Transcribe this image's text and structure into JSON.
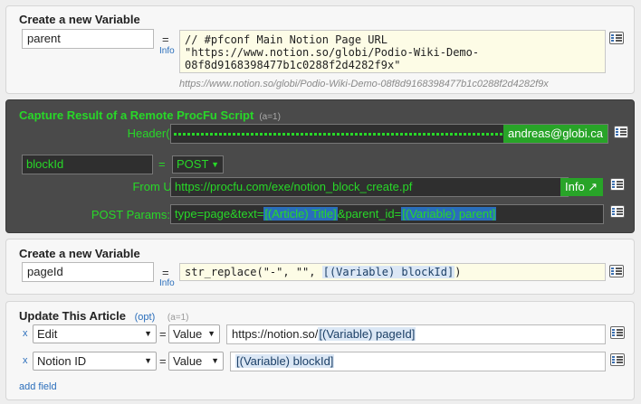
{
  "var1": {
    "title": "Create a new Variable",
    "name": "parent",
    "eq": "=",
    "info": "Info",
    "code_line1": "// #pfconf Main Notion Page URL",
    "code_line2": "\"https://www.notion.so/globi/Podio-Wiki-Demo-",
    "code_line3": "08f8d9168398477b1c0288f2d4282f9x\"",
    "result": "https://www.notion.so/globi/Podio-Wiki-Demo-08f8d9168398477b1c0288f2d4282f9x"
  },
  "procfu": {
    "title": "Capture Result of a Remote ProcFu Script",
    "subtitle": "(a=1)",
    "headers_label": "Header(s):",
    "headers_button": "andreas@globi.ca",
    "var_name": "blockId",
    "eq": "=",
    "method": "POST",
    "from_url_label": "From URL:",
    "from_url": "https://procfu.com/exe/notion_block_create.pf",
    "info_button": "Info ↗",
    "post_params_label": "POST Params:",
    "params_text1": "type=page&text=",
    "params_token1": "[(Article) Title]",
    "params_text2": "&parent_id=",
    "params_token2": "[(Variable) parent]"
  },
  "var2": {
    "title": "Create a new Variable",
    "name": "pageId",
    "eq": "=",
    "info": "Info",
    "code_text": "str_replace(\"-\", \"\", ",
    "code_token": "[(Variable) blockId]",
    "code_end": ")"
  },
  "update": {
    "title": "Update This Article",
    "opt": "(opt)",
    "subtitle": "(a=1)",
    "rows": [
      {
        "x": "x",
        "field": "Edit",
        "eq": "=",
        "mode": "Value",
        "text": "https://notion.so/",
        "token": "[(Variable) pageId]"
      },
      {
        "x": "x",
        "field": "Notion ID",
        "eq": "=",
        "mode": "Value",
        "text": "",
        "token": "[(Variable) blockId]"
      }
    ],
    "add_field": "add field"
  },
  "icons": {
    "side": "list-config-icon",
    "dropdown": "chevron-down-icon"
  }
}
